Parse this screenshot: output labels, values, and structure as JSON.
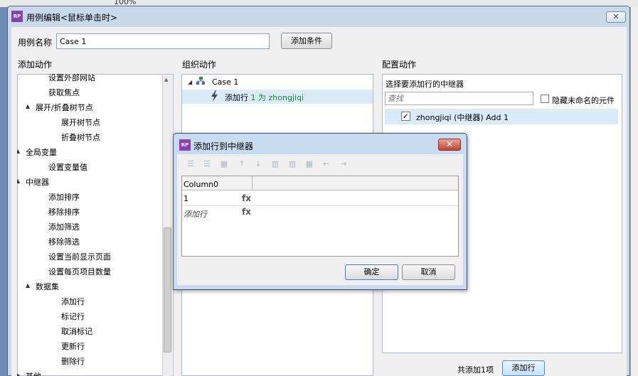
{
  "background": {
    "zoom": "100%"
  },
  "main_dialog": {
    "icon_text": "RP",
    "title": "用例编辑<鼠标单击时>",
    "close_glyph": "✕",
    "case_name_label": "用例名称",
    "case_name_value": "Case 1",
    "add_condition_button": "添加条件"
  },
  "sections": {
    "add_actions": "添加动作",
    "organize_actions": "组织动作",
    "configure_actions": "配置动作"
  },
  "left_tree": [
    {
      "label": "设置外部网站",
      "indent": 2,
      "expander": ""
    },
    {
      "label": "获取焦点",
      "indent": 2,
      "expander": ""
    },
    {
      "label": "展开/折叠树节点",
      "indent": 1,
      "expander": "▲"
    },
    {
      "label": "展开树节点",
      "indent": 3,
      "expander": ""
    },
    {
      "label": "折叠树节点",
      "indent": 3,
      "expander": ""
    },
    {
      "label": "全局变量",
      "indent": 0,
      "expander": "▲"
    },
    {
      "label": "设置变量值",
      "indent": 2,
      "expander": ""
    },
    {
      "label": "中继器",
      "indent": 0,
      "expander": "▲"
    },
    {
      "label": "添加排序",
      "indent": 2,
      "expander": ""
    },
    {
      "label": "移除排序",
      "indent": 2,
      "expander": ""
    },
    {
      "label": "添加筛选",
      "indent": 2,
      "expander": ""
    },
    {
      "label": "移除筛选",
      "indent": 2,
      "expander": ""
    },
    {
      "label": "设置当前显示页面",
      "indent": 2,
      "expander": ""
    },
    {
      "label": "设置每页项目数量",
      "indent": 2,
      "expander": ""
    },
    {
      "label": "数据集",
      "indent": 1,
      "expander": "▲"
    },
    {
      "label": "添加行",
      "indent": 3,
      "expander": ""
    },
    {
      "label": "标记行",
      "indent": 3,
      "expander": ""
    },
    {
      "label": "取消标记",
      "indent": 3,
      "expander": ""
    },
    {
      "label": "更新行",
      "indent": 3,
      "expander": ""
    },
    {
      "label": "删除行",
      "indent": 3,
      "expander": ""
    },
    {
      "label": "其他",
      "indent": 0,
      "expander": "▶"
    }
  ],
  "organize": {
    "case_label": "Case 1",
    "action_prefix": "添加行 ",
    "action_detail": "1 为 zhongjiqi"
  },
  "configure": {
    "select_label": "选择要添加行的中继器",
    "search_placeholder": "查找",
    "hide_unnamed_label": "隐藏未命名的元件",
    "repeater_item": "zhongjiqi (中继器) Add 1",
    "total_added": "共添加1项",
    "add_row_button": "添加行"
  },
  "sub_dialog": {
    "icon_text": "RP",
    "title": "添加行到中继器",
    "close_glyph": "✕",
    "toolbar_icons": [
      "insert-above-icon",
      "insert-below-icon",
      "delete-row-icon",
      "move-up-icon",
      "move-down-icon",
      "insert-col-left-icon",
      "insert-col-right-icon",
      "delete-col-icon",
      "move-left-icon",
      "move-right-icon"
    ],
    "column_header": "Column0",
    "rows": [
      {
        "value": "1",
        "fx": "fx"
      },
      {
        "value": "添加行",
        "fx": "fx"
      }
    ],
    "ok_button": "确定",
    "cancel_button": "取消"
  }
}
